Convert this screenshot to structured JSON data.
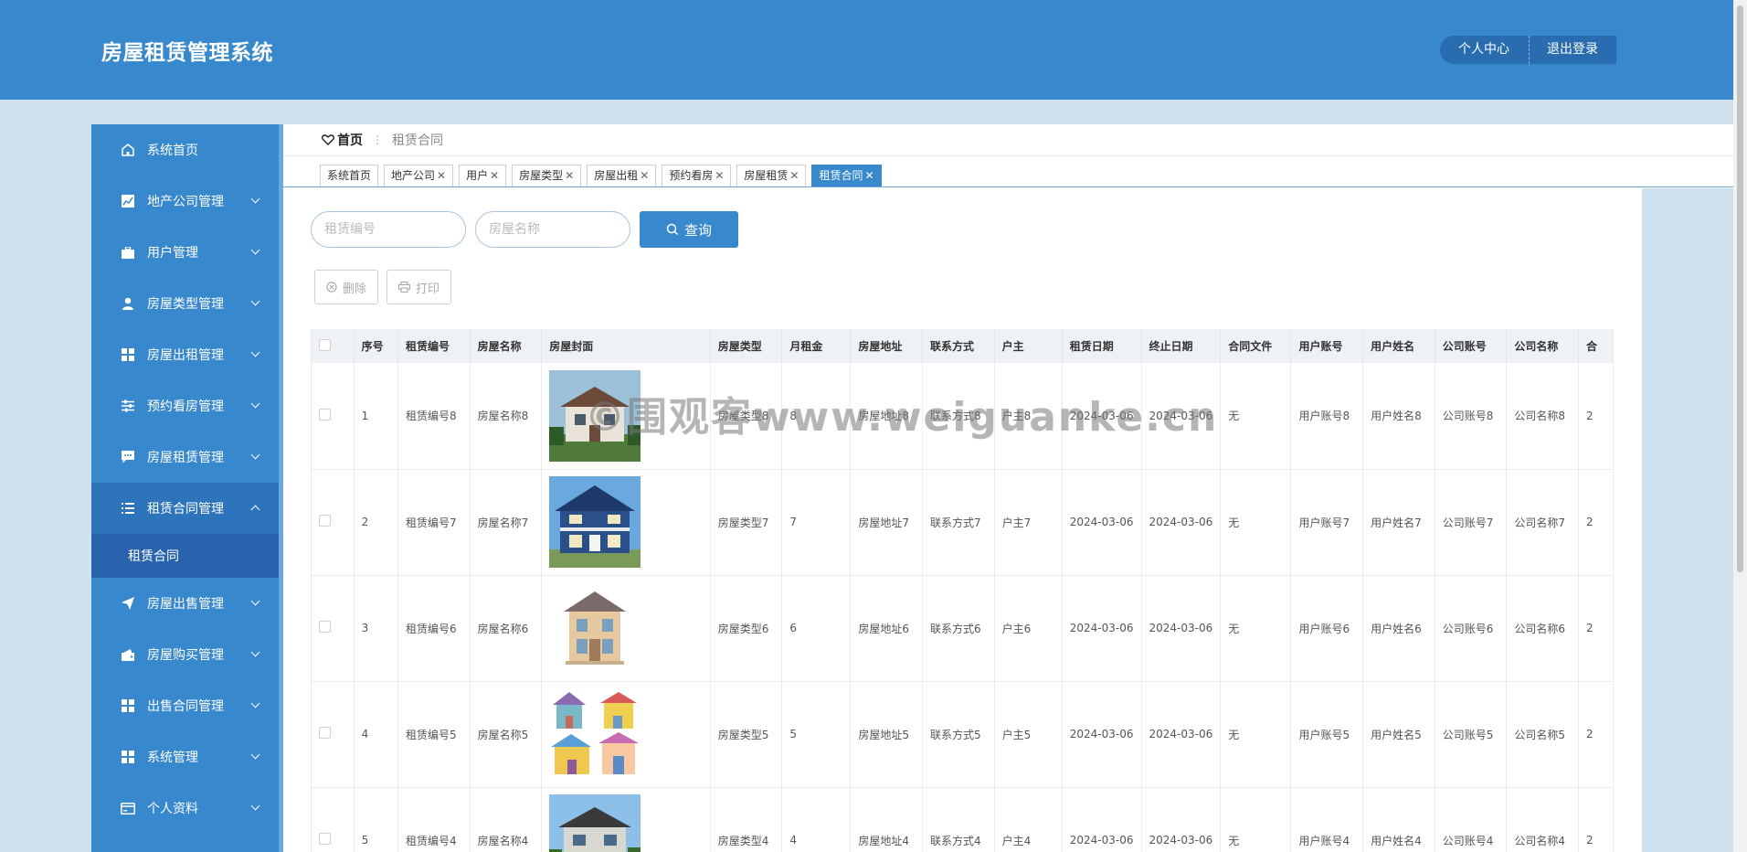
{
  "header": {
    "title": "房屋租赁管理系统",
    "profile_label": "个人中心",
    "logout_label": "退出登录"
  },
  "sidebar": {
    "items": [
      {
        "label": "系统首页",
        "icon": "home-icon",
        "has_children": false
      },
      {
        "label": "地产公司管理",
        "icon": "chart-icon",
        "has_children": true
      },
      {
        "label": "用户管理",
        "icon": "briefcase-icon",
        "has_children": true
      },
      {
        "label": "房屋类型管理",
        "icon": "user-icon",
        "has_children": true
      },
      {
        "label": "房屋出租管理",
        "icon": "grid-icon",
        "has_children": true
      },
      {
        "label": "预约看房管理",
        "icon": "sliders-icon",
        "has_children": true
      },
      {
        "label": "房屋租赁管理",
        "icon": "chat-icon",
        "has_children": true
      },
      {
        "label": "租赁合同管理",
        "icon": "list-icon",
        "has_children": true,
        "open": true
      },
      {
        "label": "房屋出售管理",
        "icon": "send-icon",
        "has_children": true
      },
      {
        "label": "房屋购买管理",
        "icon": "wallet-icon",
        "has_children": true
      },
      {
        "label": "出售合同管理",
        "icon": "grid-icon",
        "has_children": true
      },
      {
        "label": "系统管理",
        "icon": "grid-icon",
        "has_children": true
      },
      {
        "label": "个人资料",
        "icon": "card-icon",
        "has_children": true
      }
    ],
    "open_submenu": {
      "label": "租赁合同"
    }
  },
  "breadcrumb": {
    "home": "首页",
    "separator": "⋮",
    "current": "租赁合同"
  },
  "tabs": [
    {
      "label": "系统首页",
      "closable": false,
      "active": false
    },
    {
      "label": "地产公司",
      "closable": true,
      "active": false
    },
    {
      "label": "用户",
      "closable": true,
      "active": false
    },
    {
      "label": "房屋类型",
      "closable": true,
      "active": false
    },
    {
      "label": "房屋出租",
      "closable": true,
      "active": false
    },
    {
      "label": "预约看房",
      "closable": true,
      "active": false
    },
    {
      "label": "房屋租赁",
      "closable": true,
      "active": false
    },
    {
      "label": "租赁合同",
      "closable": true,
      "active": true
    }
  ],
  "search": {
    "contract_no_placeholder": "租赁编号",
    "house_name_placeholder": "房屋名称",
    "query_label": "查询"
  },
  "actions": {
    "delete_label": "删除",
    "print_label": "打印"
  },
  "table": {
    "columns": [
      "序号",
      "租赁编号",
      "房屋名称",
      "房屋封面",
      "房屋类型",
      "月租金",
      "房屋地址",
      "联系方式",
      "户主",
      "租赁日期",
      "终止日期",
      "合同文件",
      "用户账号",
      "用户姓名",
      "公司账号",
      "公司名称",
      "合"
    ],
    "rows": [
      {
        "seq": "1",
        "contract_no": "租赁编号8",
        "house_name": "房屋名称8",
        "cover": "villa-a",
        "house_type": "房屋类型8",
        "rent": "8",
        "address": "房屋地址8",
        "contact": "联系方式8",
        "owner": "户主8",
        "start_date": "2024-03-06",
        "end_date": "2024-03-06",
        "contract_file": "无",
        "user_account": "用户账号8",
        "user_name": "用户姓名8",
        "company_account": "公司账号8",
        "company_name": "公司名称8",
        "extra": "2"
      },
      {
        "seq": "2",
        "contract_no": "租赁编号7",
        "house_name": "房屋名称7",
        "cover": "villa-b",
        "house_type": "房屋类型7",
        "rent": "7",
        "address": "房屋地址7",
        "contact": "联系方式7",
        "owner": "户主7",
        "start_date": "2024-03-06",
        "end_date": "2024-03-06",
        "contract_file": "无",
        "user_account": "用户账号7",
        "user_name": "用户姓名7",
        "company_account": "公司账号7",
        "company_name": "公司名称7",
        "extra": "2"
      },
      {
        "seq": "3",
        "contract_no": "租赁编号6",
        "house_name": "房屋名称6",
        "cover": "villa-c",
        "house_type": "房屋类型6",
        "rent": "6",
        "address": "房屋地址6",
        "contact": "联系方式6",
        "owner": "户主6",
        "start_date": "2024-03-06",
        "end_date": "2024-03-06",
        "contract_file": "无",
        "user_account": "用户账号6",
        "user_name": "用户姓名6",
        "company_account": "公司账号6",
        "company_name": "公司名称6",
        "extra": "2"
      },
      {
        "seq": "4",
        "contract_no": "租赁编号5",
        "house_name": "房屋名称5",
        "cover": "cartoon-houses",
        "house_type": "房屋类型5",
        "rent": "5",
        "address": "房屋地址5",
        "contact": "联系方式5",
        "owner": "户主5",
        "start_date": "2024-03-06",
        "end_date": "2024-03-06",
        "contract_file": "无",
        "user_account": "用户账号5",
        "user_name": "用户姓名5",
        "company_account": "公司账号5",
        "company_name": "公司名称5",
        "extra": "2"
      },
      {
        "seq": "5",
        "contract_no": "租赁编号4",
        "house_name": "房屋名称4",
        "cover": "villa-d",
        "house_type": "房屋类型4",
        "rent": "4",
        "address": "房屋地址4",
        "contact": "联系方式4",
        "owner": "户主4",
        "start_date": "2024-03-06",
        "end_date": "2024-03-06",
        "contract_file": "无",
        "user_account": "用户账号4",
        "user_name": "用户姓名4",
        "company_account": "公司账号4",
        "company_name": "公司名称4",
        "extra": "2"
      }
    ]
  },
  "watermark": "©围观客www.weiguanke.cn",
  "colors": {
    "primary": "#3888cd",
    "primary_dark": "#2a6cb0",
    "page_bg": "#cfe0ee"
  }
}
